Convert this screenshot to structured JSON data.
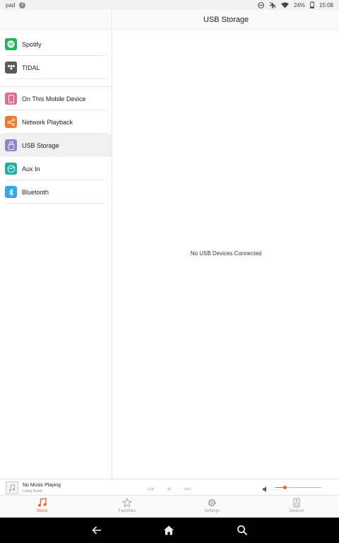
{
  "status_bar": {
    "carrier": "pad",
    "notification_count": "2",
    "battery": "24%",
    "time": "15:08"
  },
  "sources_group1": [
    {
      "label": "Spotify",
      "icon": "spotify-icon",
      "color": "#1db954"
    },
    {
      "label": "TIDAL",
      "icon": "tidal-icon",
      "color": "#5a5a5a"
    }
  ],
  "sources_group2": [
    {
      "label": "On This Mobile Device",
      "icon": "mobile-device-icon",
      "color": "#e46a8a"
    },
    {
      "label": "Network Playback",
      "icon": "share-icon",
      "color": "#f07a2a"
    },
    {
      "label": "USB Storage",
      "icon": "usb-icon",
      "color": "#8b86c9",
      "selected": true
    },
    {
      "label": "Aux In",
      "icon": "aux-icon",
      "color": "#1bb2a4"
    },
    {
      "label": "Bluetooth",
      "icon": "bluetooth-icon",
      "color": "#2fa8e6"
    }
  ],
  "detail": {
    "title": "USB Storage",
    "empty_message": "No USB Devices Connected"
  },
  "now_playing": {
    "title": "No Music Playing",
    "room": "Living Room",
    "volume": 0.2
  },
  "tabs": [
    {
      "label": "Music",
      "icon": "music-note-icon",
      "active": true
    },
    {
      "label": "Favorites",
      "icon": "star-icon"
    },
    {
      "label": "Settings",
      "icon": "gear-icon"
    },
    {
      "label": "Devices",
      "icon": "speaker-icon"
    }
  ],
  "colors": {
    "accent": "#e8652b"
  }
}
